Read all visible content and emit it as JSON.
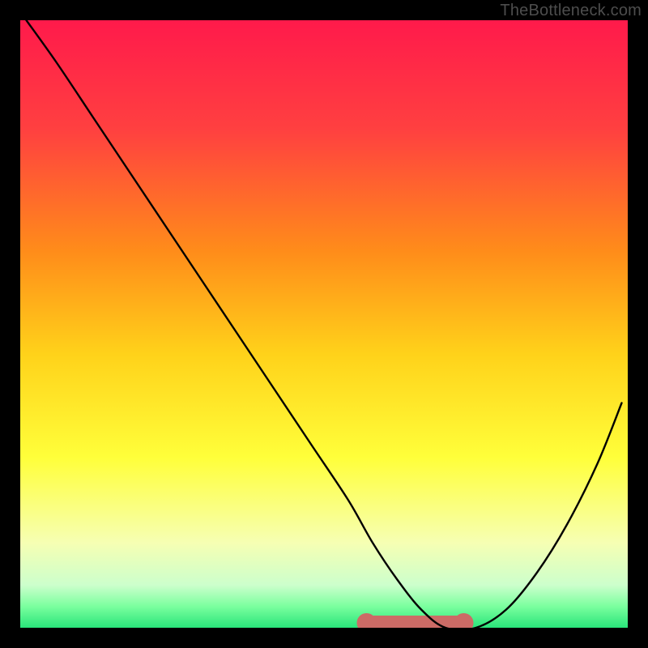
{
  "watermark": "TheBottleneck.com",
  "chart_data": {
    "type": "line",
    "title": "",
    "xlabel": "",
    "ylabel": "",
    "xlim": [
      0,
      100
    ],
    "ylim": [
      0,
      100
    ],
    "background_gradient": {
      "stops": [
        {
          "offset": 0.0,
          "color": "#ff1a4b"
        },
        {
          "offset": 0.18,
          "color": "#ff4040"
        },
        {
          "offset": 0.38,
          "color": "#ff8c1a"
        },
        {
          "offset": 0.55,
          "color": "#ffd21a"
        },
        {
          "offset": 0.72,
          "color": "#ffff3a"
        },
        {
          "offset": 0.86,
          "color": "#f6ffb3"
        },
        {
          "offset": 0.93,
          "color": "#ccffcc"
        },
        {
          "offset": 0.965,
          "color": "#7aff9e"
        },
        {
          "offset": 1.0,
          "color": "#29e57a"
        }
      ]
    },
    "series": [
      {
        "name": "bottleneck-curve",
        "color": "#000000",
        "x": [
          1,
          6,
          12,
          18,
          24,
          30,
          36,
          42,
          48,
          54,
          58,
          62,
          66,
          70,
          75,
          80,
          85,
          90,
          95,
          99
        ],
        "y": [
          100,
          93,
          84,
          75,
          66,
          57,
          48,
          39,
          30,
          21,
          14,
          8,
          3,
          0,
          0,
          3,
          9,
          17,
          27,
          37
        ]
      }
    ],
    "optimal_segment": {
      "color": "#cc6b66",
      "x_start": 57,
      "x_end": 73,
      "y": 0.8,
      "height": 2.4,
      "end_radius": 1.6
    }
  }
}
